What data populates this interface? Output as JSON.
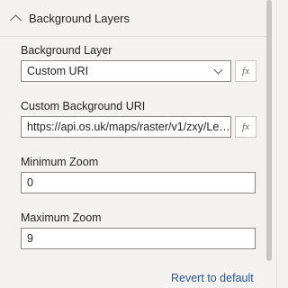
{
  "section": {
    "title": "Background Layers",
    "expanded": true
  },
  "background_layer": {
    "label": "Background Layer",
    "value": "Custom URI",
    "fx": "fx"
  },
  "custom_uri": {
    "label": "Custom Background URI",
    "value": "https://api.os.uk/maps/raster/v1/zxy/Lei...",
    "fx": "fx"
  },
  "min_zoom": {
    "label": "Minimum Zoom",
    "value": "0"
  },
  "max_zoom": {
    "label": "Maximum Zoom",
    "value": "9"
  },
  "revert_label": "Revert to default"
}
